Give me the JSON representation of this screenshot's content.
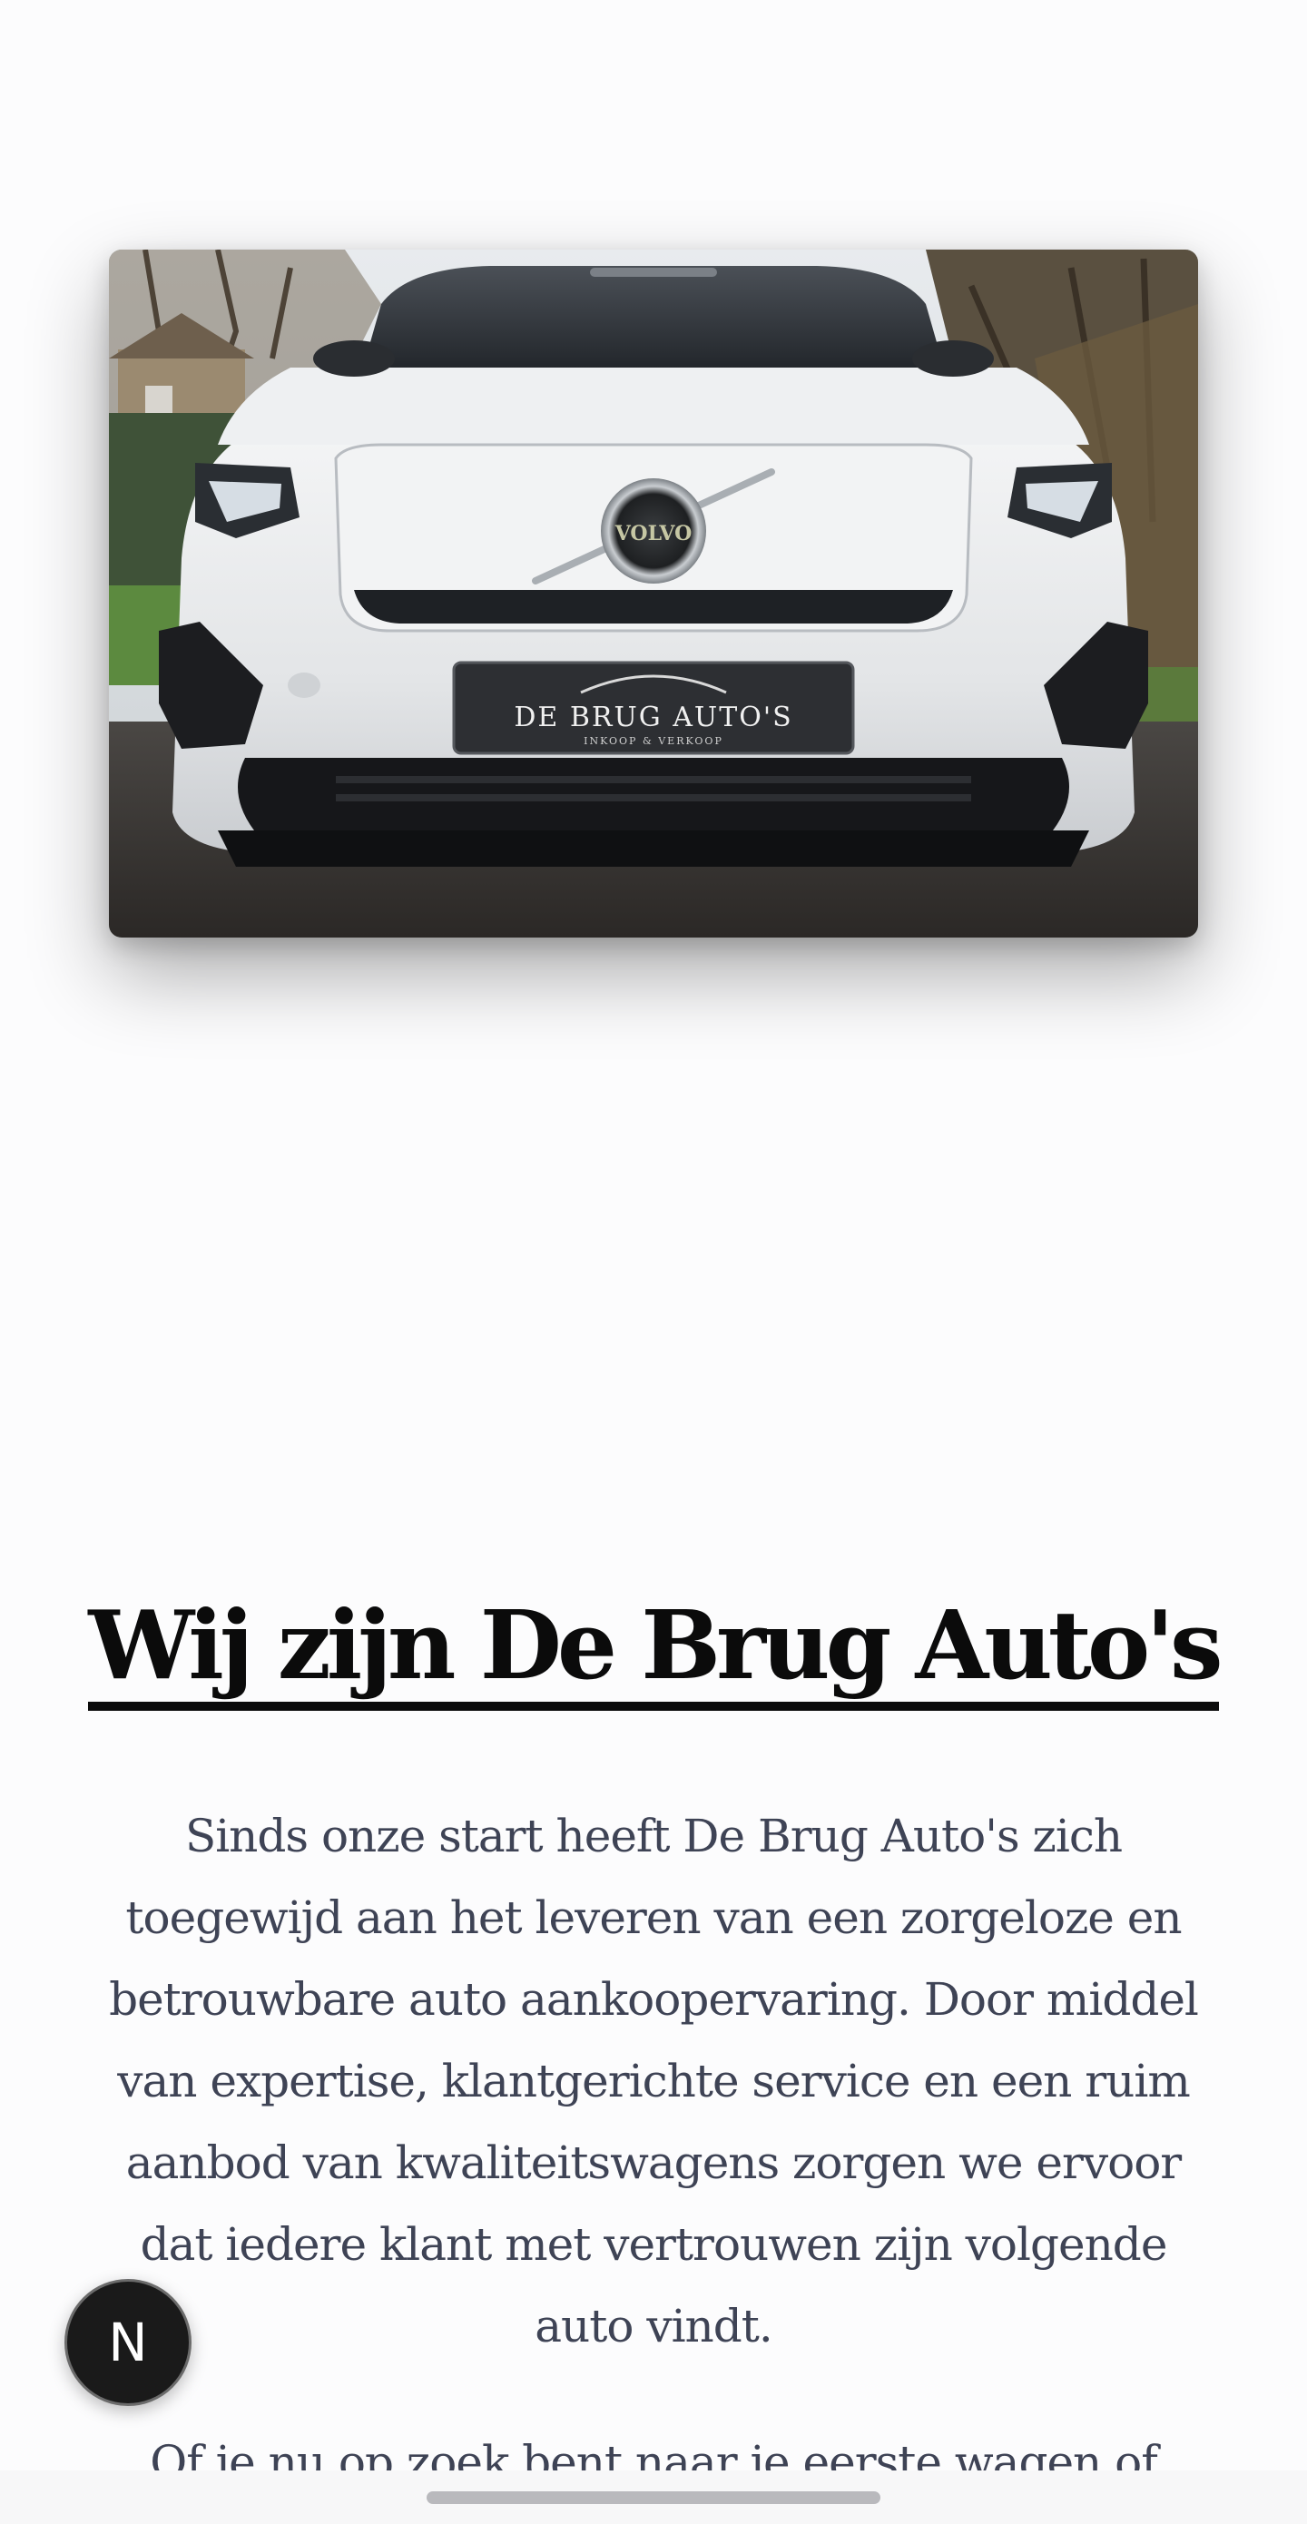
{
  "hero": {
    "image_alt": "Witte Volvo met kenteken De Brug Auto's",
    "plate_title": "DE BRUG AUTO'S",
    "plate_subtitle": "INKOOP & VERKOOP",
    "badge_text": "VOLVO"
  },
  "about": {
    "title": "Wij zijn De Brug Auto's",
    "intro": "Sinds onze start heeft De Brug Auto's zich toegewijd aan het leveren van een zorgeloze en betrouwbare auto aankoopervaring. Door middel van expertise, klantgerichte service en een ruim aanbod van kwaliteitswagens zorgen we ervoor dat iedere klant met vertrouwen zijn volgende auto vindt.",
    "next_paragraph_start": "Of je nu op zoek bent naar je eerste wagen of"
  },
  "floating_badge": {
    "letter": "N"
  }
}
